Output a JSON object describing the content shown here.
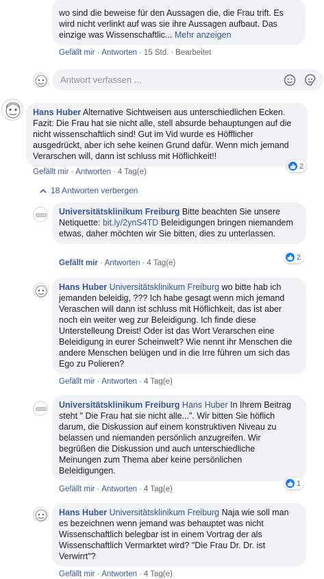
{
  "top_comment": {
    "text": "wo sind die beweise für den Aussagen die, die Frau trift. Es wird nicht verlinkt auf was sie ihre Aussagen aufbaut. Das einzige was Wissenschaftlic...",
    "more": "Mehr anzeigen",
    "like": "Gefällt mir",
    "reply": "Antworten",
    "time": "15 Std.",
    "edited": "Bearbeitet"
  },
  "reply_input": {
    "placeholder": "Antwort verfassen ..."
  },
  "comment_main": {
    "author": "Hans Huber",
    "text": "Alternative Sichtweisen aus unterschiedlichen Ecken. Fazit: Die Frau hat sie nicht alle, stell absurde behauptungen auf die nicht wissenschaftlich sind! Gut im Vid wurde es Höfflicher ausgedrückt, aber ich sehe keinen Grund dafür. Wenn mich jemand Verarschen will, dann ist schluss mit Höflichkeit!!",
    "like": "Gefällt mir",
    "reply": "Antworten",
    "time": "4 Tag(e)",
    "reactions": "2"
  },
  "replies_toggle": "18 Antworten verbergen",
  "replies": [
    {
      "author": "Universitätsklinikum Freiburg",
      "text1": "Bitte beachten Sie unsere Netiquette:",
      "link": "bit.ly/2ynS4TD",
      "text2": "Beleidigungen bringen niemandem etwas, daher möchten wir Sie bitten, dies zu unterlassen.",
      "like": "Gefällt mir",
      "reply": "Antworten",
      "time": "4 Tag(e)",
      "reactions": "2"
    },
    {
      "author": "Hans Huber",
      "mention": "Universitätsklinikum Freiburg",
      "text": "wo bitte hab ich jemanden beleidig, ??? Ich habe gesagt wenn mich jemand Veraschen will dann ist schluss mit Höflichkeit, das ist aber noch ein weiter weg zur Beleidigung. Ich finde diese Unterstelleung Dreist! Oder ist das Wort Verarschen eine Beleidigung in eurer Scheinwelt? Wie nennt ihr Menschen die andere Menschen belügen und in die Irre führen um sich das Ego zu Polieren?",
      "like": "Gefällt mir",
      "reply": "Antworten",
      "time": "4 Tag(e)"
    },
    {
      "author": "Universitätsklinikum Freiburg",
      "mention": "Hans Huber",
      "text": "In Ihrem Beitrag steht \" Die Frau hat sie nicht alle...\". Wir bitten Sie höflich darum, die Diskussion auf einem konstruktiven Niveau zu belassen und niemanden persönlich anzugreifen. Wir begrüßen die Diskussion und auch unterschiedliche Meinungen zum Thema aber keine persönlichen Beleidigungen.",
      "like": "Gefällt mir",
      "reply": "Antworten",
      "time": "4 Tag(e)",
      "reactions": "1"
    },
    {
      "author": "Hans Huber",
      "mention": "Universitätsklinikum Freiburg",
      "text": "Naja wie soll man es bezeichnen wenn jemand was behauptet was nicht Wissenschaftlich belegbar ist in einem Vortrag der als Wissenschaftlich Vermarktet wird? \"Die Frau Dr. Dr. ist Verwirrt\"?",
      "like": "Gefällt mir",
      "reply": "Antworten",
      "time": "4 Tag(e)"
    }
  ],
  "colors": {
    "link": "#385898",
    "bubble": "#f0f2f5",
    "like_blue": "#1877f2"
  }
}
